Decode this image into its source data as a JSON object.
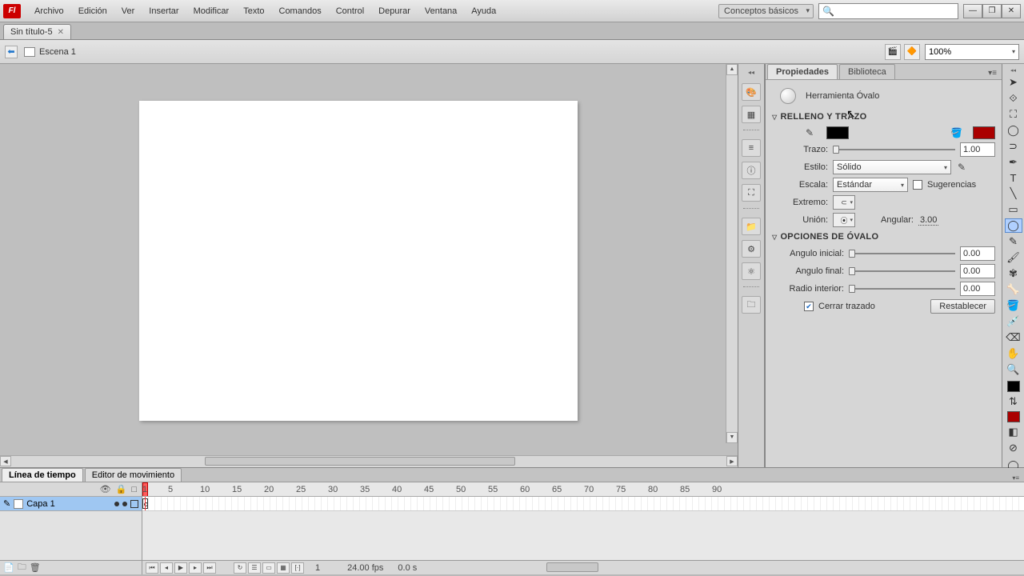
{
  "menubar": {
    "items": [
      "Archivo",
      "Edición",
      "Ver",
      "Insertar",
      "Modificar",
      "Texto",
      "Comandos",
      "Control",
      "Depurar",
      "Ventana",
      "Ayuda"
    ],
    "workspace": "Conceptos básicos"
  },
  "doc": {
    "tab_title": "Sin título-5"
  },
  "editbar": {
    "scene": "Escena 1",
    "zoom": "100%"
  },
  "props": {
    "tabs": {
      "propiedades": "Propiedades",
      "biblioteca": "Biblioteca"
    },
    "tool_name": "Herramienta Óvalo",
    "section_fill": "RELLENO Y TRAZO",
    "trazo_label": "Trazo:",
    "trazo_value": "1.00",
    "estilo_label": "Estilo:",
    "estilo_value": "Sólido",
    "escala_label": "Escala:",
    "escala_value": "Estándar",
    "sugerencias_label": "Sugerencias",
    "extremo_label": "Extremo:",
    "union_label": "Unión:",
    "angular_label": "Angular:",
    "angular_value": "3.00",
    "section_oval": "OPCIONES DE ÓVALO",
    "ang_inicial_label": "Angulo inicial:",
    "ang_inicial_value": "0.00",
    "ang_final_label": "Angulo final:",
    "ang_final_value": "0.00",
    "radio_interior_label": "Radio interior:",
    "radio_interior_value": "0.00",
    "cerrar_label": "Cerrar trazado",
    "restablecer_label": "Restablecer"
  },
  "timeline": {
    "tabs": {
      "linea": "Línea de tiempo",
      "editor": "Editor de movimiento"
    },
    "layer_name": "Capa 1",
    "ruler_marks": [
      1,
      5,
      10,
      15,
      20,
      25,
      30,
      35,
      40,
      45,
      50,
      55,
      60,
      65,
      70,
      75,
      80,
      85,
      90
    ],
    "frame_num": "1",
    "fps": "24.00 fps",
    "time": "0.0 s"
  }
}
